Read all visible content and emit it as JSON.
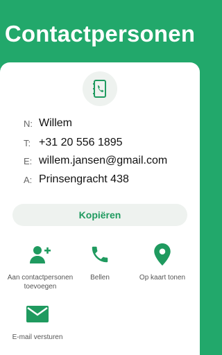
{
  "header": {
    "title": "Contactpersonen"
  },
  "contact": {
    "fields": [
      {
        "key": "N:",
        "value": "Willem"
      },
      {
        "key": "T:",
        "value": "+31 20 556 1895"
      },
      {
        "key": "E:",
        "value": "willem.jansen@gmail.com"
      },
      {
        "key": "A:",
        "value": "Prinsengracht 438"
      }
    ]
  },
  "copy_button": {
    "label": "Kopiëren"
  },
  "actions": [
    {
      "label": "Aan contactpersonen toevoegen",
      "icon": "add-contact-icon"
    },
    {
      "label": "Bellen",
      "icon": "phone-icon"
    },
    {
      "label": "Op kaart tonen",
      "icon": "map-pin-icon"
    },
    {
      "label": "E-mail versturen",
      "icon": "mail-icon"
    }
  ],
  "colors": {
    "accent": "#22a86b",
    "icon": "#1f9a5f",
    "surface": "#eef2ef"
  }
}
